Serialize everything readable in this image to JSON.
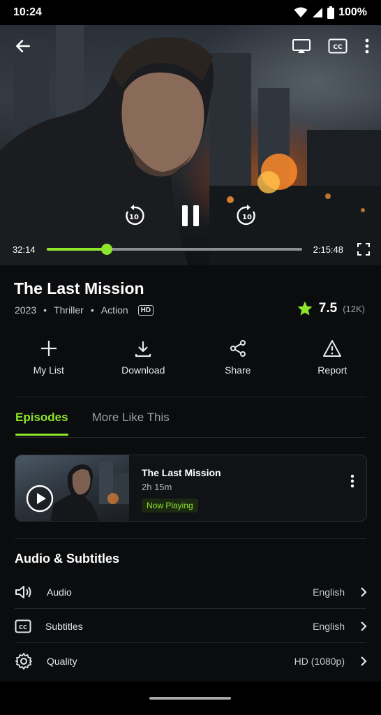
{
  "status_bar": {
    "time": "10:24",
    "battery": "100%"
  },
  "player": {
    "elapsed": "32:14",
    "duration": "2:15:48",
    "progress_fraction": 0.2373,
    "skip_back_seconds": "10",
    "skip_forward_seconds": "10",
    "cc_label": "CC"
  },
  "movie": {
    "title": "The Last Mission",
    "year": "2023",
    "genres": [
      "Thriller",
      "Action"
    ],
    "quality_badge": "HD",
    "rating": "7.5",
    "rating_count": "(12K)"
  },
  "actions": [
    {
      "label": "My List",
      "icon": "plus-icon"
    },
    {
      "label": "Download",
      "icon": "download-icon"
    },
    {
      "label": "Share",
      "icon": "share-icon"
    },
    {
      "label": "Report",
      "icon": "warning-icon"
    }
  ],
  "tabs": [
    {
      "label": "Episodes",
      "active": true
    },
    {
      "label": "More Like This",
      "active": false
    }
  ],
  "episode": {
    "title": "The Last Mission",
    "duration": "2h 15m",
    "status": "Now Playing"
  },
  "audio_subtitles": {
    "title": "Audio & Subtitles",
    "rows": [
      {
        "label": "Audio",
        "value": "English",
        "icon": "speaker-icon"
      },
      {
        "label": "Subtitles",
        "value": "English",
        "icon": "cc-icon"
      },
      {
        "label": "Quality",
        "value": "HD (1080p)",
        "icon": "gear-icon"
      }
    ]
  },
  "colors": {
    "accent": "#8ee62a",
    "background": "#0b0c0e"
  }
}
